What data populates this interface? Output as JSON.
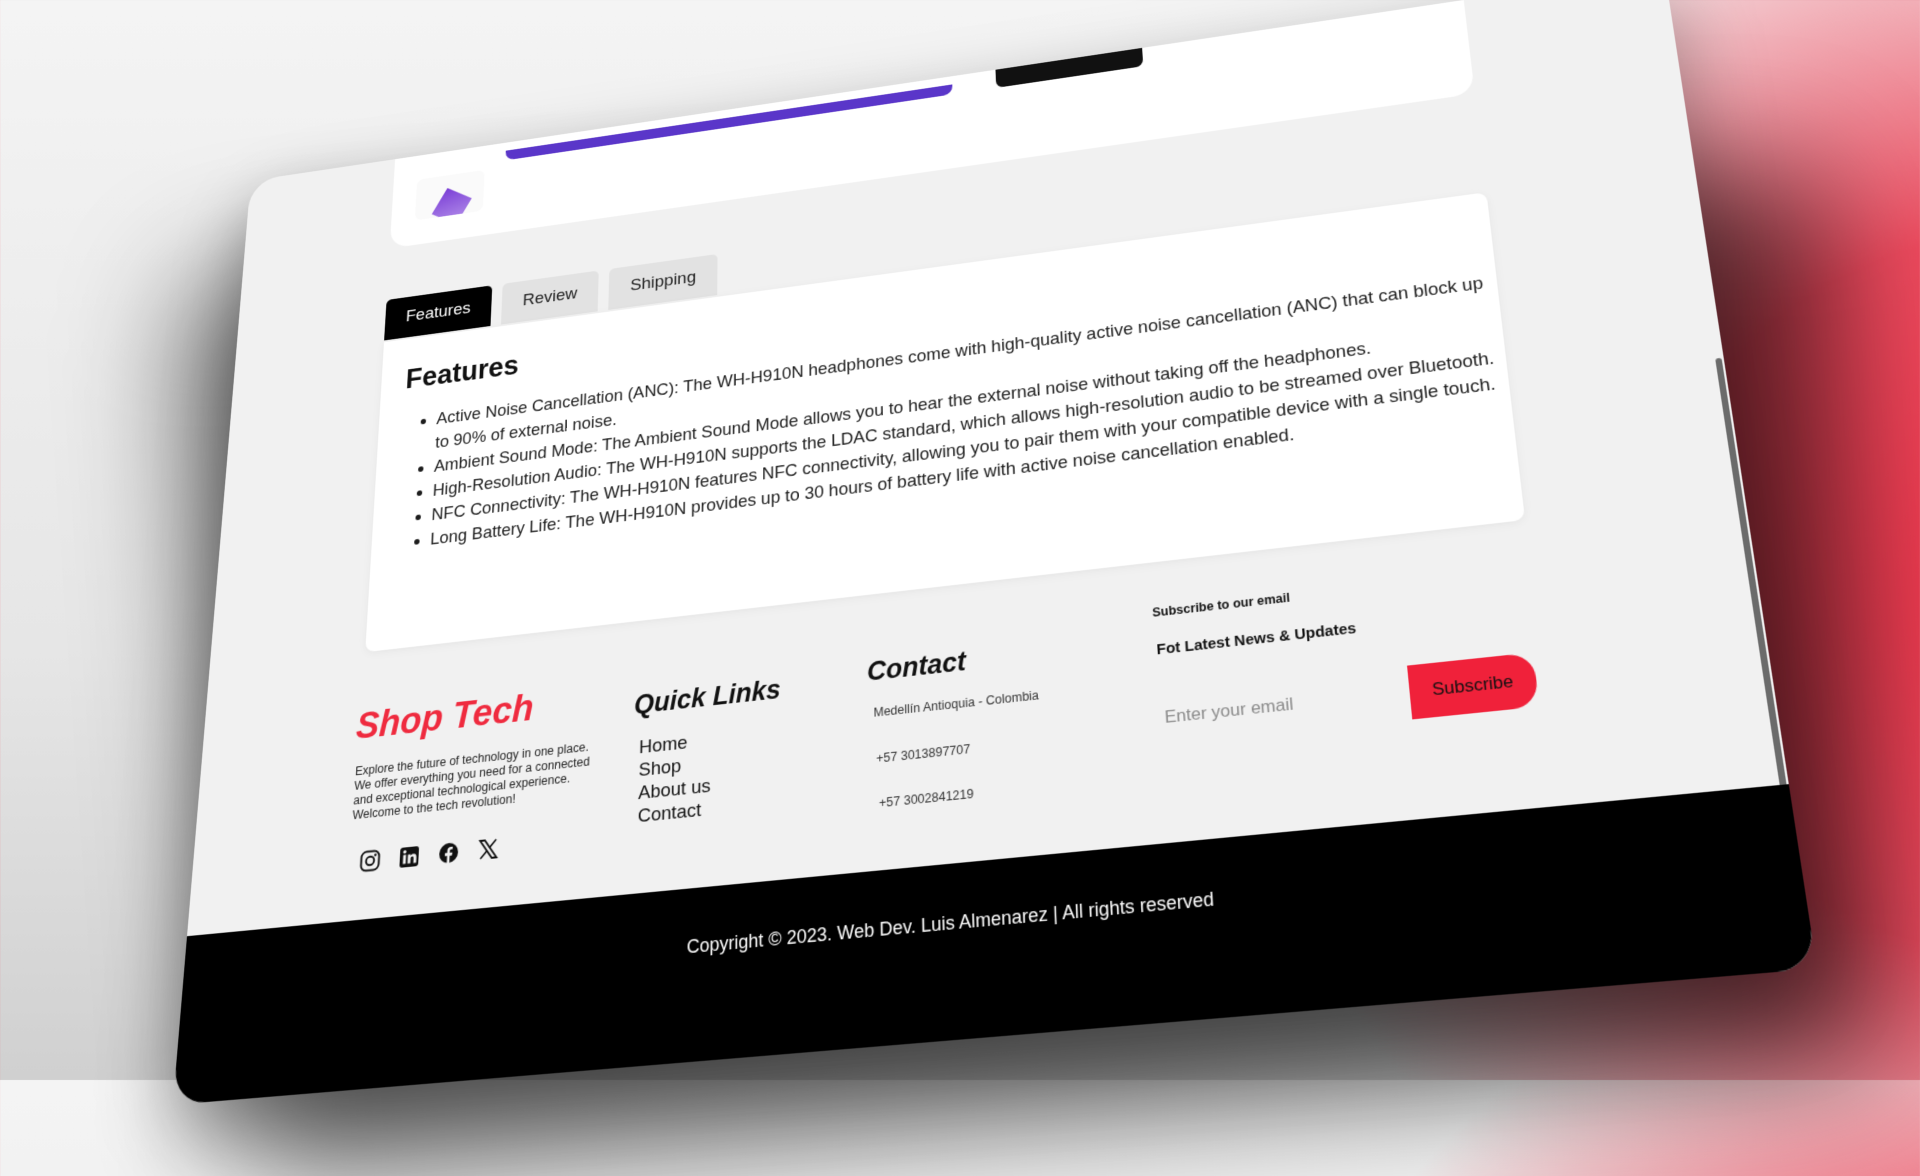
{
  "tabs": [
    {
      "label": "Features",
      "active": true
    },
    {
      "label": "Review",
      "active": false
    },
    {
      "label": "Shipping",
      "active": false
    }
  ],
  "features": {
    "title": "Features",
    "items": [
      "Active Noise Cancellation (ANC): The WH-H910N headphones come with high-quality active noise cancellation (ANC) that can block up to 90% of external noise.",
      "Ambient Sound Mode: The Ambient Sound Mode allows you to hear the external noise without taking off the headphones.",
      "High-Resolution Audio: The WH-H910N supports the LDAC standard, which allows high-resolution audio to be streamed over Bluetooth.",
      "NFC Connectivity: The WH-H910N features NFC connectivity, allowing you to pair them with your compatible device with a single touch.",
      "Long Battery Life: The WH-H910N provides up to 30 hours of battery life with active noise cancellation enabled."
    ]
  },
  "footer": {
    "brand": "Shop Tech",
    "description": "Explore the future of technology in one place. We offer everything you need for a connected and exceptional technological experience. Welcome to the tech revolution!",
    "socials": [
      "instagram-icon",
      "linkedin-icon",
      "facebook-icon",
      "x-icon"
    ],
    "quick_links_title": "Quick Links",
    "quick_links": [
      "Home",
      "Shop",
      "About us",
      "Contact"
    ],
    "contact_title": "Contact",
    "contact": {
      "address": "Medellín Antioquia - Colombia",
      "phone1": "+57 3013897707",
      "phone2": "+57 3002841219"
    },
    "subscribe_label": "Subscribe to our email",
    "subscribe_title": "Fot Latest News & Updates",
    "email_placeholder": "Enter your email",
    "subscribe_button": "Subscribe",
    "copyright": "Copyright © 2023. Web Dev. Luis Almenarez | All rights reserved"
  },
  "colors": {
    "accent": "#ef2b3f",
    "subscribe_bg": "#f0213a",
    "footer_bar": "#000000",
    "tab_active": "#000000",
    "progress": "#5a36c9"
  }
}
